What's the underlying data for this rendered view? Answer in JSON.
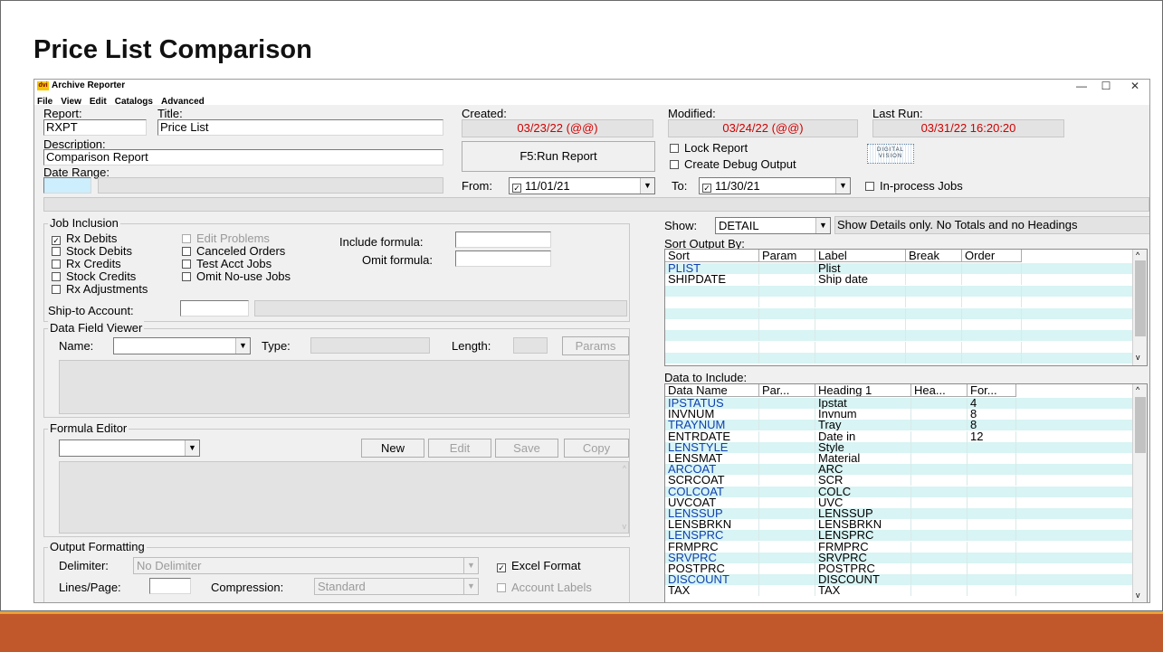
{
  "slide": {
    "title": "Price List Comparison"
  },
  "window": {
    "app_title": "Archive Reporter",
    "icon_text": "dvi",
    "buttons": [
      "—",
      "☐",
      "✕"
    ]
  },
  "menu": [
    "File",
    "View",
    "Edit",
    "Catalogs",
    "Advanced"
  ],
  "report": {
    "report_label": "Report:",
    "report_value": "RXPT",
    "title_label": "Title:",
    "title_value": "Price List",
    "created_label": "Created:",
    "created_value": "03/23/22 (@@)",
    "modified_label": "Modified:",
    "modified_value": "03/24/22 (@@)",
    "lastrun_label": "Last Run:",
    "lastrun_value": "03/31/22 16:20:20",
    "description_label": "Description:",
    "description_value": "Comparison Report",
    "date_range_label": "Date Range:",
    "run_button": "F5:Run Report",
    "lock_report": "Lock Report",
    "debug_output": "Create Debug Output",
    "logo_text": "DIGITAL VISION",
    "from_label": "From:",
    "from_value": "11/01/21",
    "to_label": "To:",
    "to_value": "11/30/21",
    "inprocess_label": "In-process Jobs"
  },
  "job_inclusion": {
    "title": "Job Inclusion",
    "col1": [
      {
        "label": "Rx Debits",
        "checked": true
      },
      {
        "label": "Stock Debits",
        "checked": false
      },
      {
        "label": "Rx Credits",
        "checked": false
      },
      {
        "label": "Stock Credits",
        "checked": false
      },
      {
        "label": "Rx Adjustments",
        "checked": false
      }
    ],
    "col2": [
      {
        "label": "Edit Problems",
        "checked": false,
        "disabled": true
      },
      {
        "label": "Canceled Orders",
        "checked": false
      },
      {
        "label": "Test Acct Jobs",
        "checked": false
      },
      {
        "label": "Omit No-use Jobs",
        "checked": false
      }
    ],
    "include_formula_label": "Include formula:",
    "omit_formula_label": "Omit formula:",
    "shipto_label": "Ship-to Account:"
  },
  "data_field_viewer": {
    "title": "Data Field Viewer",
    "name_label": "Name:",
    "type_label": "Type:",
    "length_label": "Length:",
    "params_button": "Params"
  },
  "formula_editor": {
    "title": "Formula Editor",
    "buttons": [
      "New",
      "Edit",
      "Save",
      "Copy"
    ]
  },
  "output_formatting": {
    "title": "Output Formatting",
    "delimiter_label": "Delimiter:",
    "delimiter_value": "No Delimiter",
    "excel_label": "Excel Format",
    "excel_checked": true,
    "lines_label": "Lines/Page:",
    "compression_label": "Compression:",
    "compression_value": "Standard",
    "account_labels": "Account Labels"
  },
  "show": {
    "label": "Show:",
    "value": "DETAIL",
    "description": "Show Details only. No Totals and no Headings"
  },
  "sort_output": {
    "label": "Sort Output By:",
    "headers": [
      "Sort",
      "Param",
      "Label",
      "Break",
      "Order"
    ],
    "rows": [
      [
        "PLIST",
        "",
        "Plist",
        "",
        ""
      ],
      [
        "SHIPDATE",
        "",
        "Ship date",
        "",
        ""
      ]
    ]
  },
  "data_include": {
    "label": "Data to Include:",
    "headers": [
      "Data Name",
      "Par...",
      "Heading 1",
      "Hea...",
      "For..."
    ],
    "rows": [
      [
        "IPSTATUS",
        "",
        "Ipstat",
        "",
        "4"
      ],
      [
        "INVNUM",
        "",
        "Invnum",
        "",
        "8"
      ],
      [
        "TRAYNUM",
        "",
        "Tray",
        "",
        "8"
      ],
      [
        "ENTRDATE",
        "",
        "Date in",
        "",
        "12"
      ],
      [
        "LENSTYLE",
        "",
        "Style",
        "",
        ""
      ],
      [
        "LENSMAT",
        "",
        "Material",
        "",
        ""
      ],
      [
        "ARCOAT",
        "",
        "ARC",
        "",
        ""
      ],
      [
        "SCRCOAT",
        "",
        "SCR",
        "",
        ""
      ],
      [
        "COLCOAT",
        "",
        "COLC",
        "",
        ""
      ],
      [
        "UVCOAT",
        "",
        "UVC",
        "",
        ""
      ],
      [
        "LENSSUP",
        "",
        "LENSSUP",
        "",
        ""
      ],
      [
        "LENSBRKN",
        "",
        "LENSBRKN",
        "",
        ""
      ],
      [
        "LENSPRC",
        "",
        "LENSPRC",
        "",
        ""
      ],
      [
        "FRMPRC",
        "",
        "FRMPRC",
        "",
        ""
      ],
      [
        "SRVPRC",
        "",
        "SRVPRC",
        "",
        ""
      ],
      [
        "POSTPRC",
        "",
        "POSTPRC",
        "",
        ""
      ],
      [
        "DISCOUNT",
        "",
        "DISCOUNT",
        "",
        ""
      ],
      [
        "TAX",
        "",
        "TAX",
        "",
        ""
      ]
    ]
  }
}
